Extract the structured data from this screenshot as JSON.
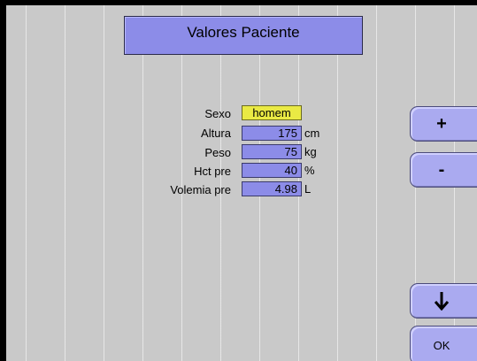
{
  "title": "Valores Paciente",
  "fields": [
    {
      "label": "Sexo",
      "value": "homem",
      "unit": ""
    },
    {
      "label": "Altura",
      "value": "175",
      "unit": "cm"
    },
    {
      "label": "Peso",
      "value": "75",
      "unit": "kg"
    },
    {
      "label": "Hct pre",
      "value": "40",
      "unit": "%"
    },
    {
      "label": "Volemia pre",
      "value": "4.98",
      "unit": "L"
    }
  ],
  "buttons": {
    "plus": "+",
    "minus": "-",
    "down_icon": "arrow-down-icon",
    "ok": "OK"
  },
  "colors": {
    "screen_bg": "#c9c9c9",
    "field_bg": "#8c8ce8",
    "sex_field_bg": "#eaea44",
    "button_bg": "#aaaaf0"
  }
}
